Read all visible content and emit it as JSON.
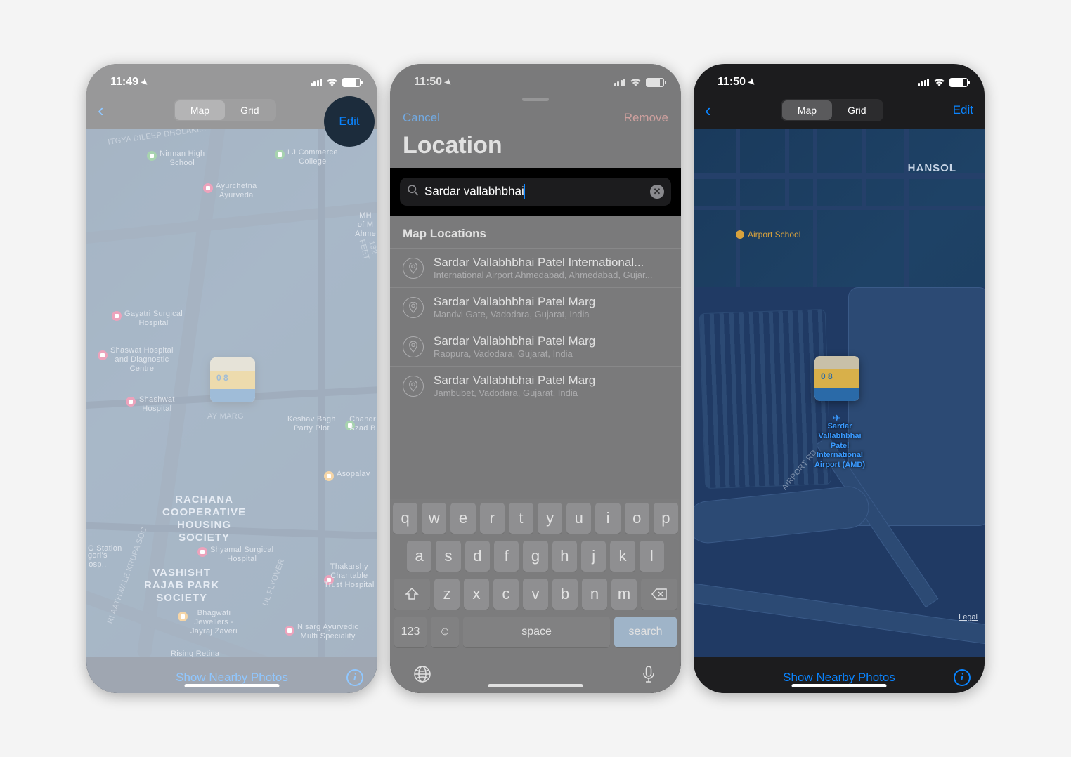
{
  "screen1": {
    "time": "11:49",
    "nav": {
      "back": "‹",
      "map": "Map",
      "grid": "Grid",
      "edit": "Edit"
    },
    "map_labels": {
      "nirman": "Nirman High\nSchool",
      "lj": "LJ Commerce\nCollege",
      "ayur": "Ayurchetna\nAyurveda",
      "mh": "MH\nof M\nAhme",
      "gayatri": "Gayatri Surgical\nHospital",
      "shaswat": "Shaswat Hospital\nand Diagnostic\nCentre",
      "shashwat": "Shashwat\nHospital",
      "keshav": "Keshav Bagh\nParty Plot",
      "chandra": "Chandr\nAzad B",
      "asopalav": "Asopalav",
      "rachana": "RACHANA\nCOOPERATIVE\nHOUSING\nSOCIETY",
      "gstation": "G Station",
      "shyamal": "Shyamal Surgical\nHospital",
      "gori": "gori's\nosp..",
      "vashisht": "VASHISHT\nRAJAB PARK\nSOCIETY",
      "thakarshy": "Thakarshy\nCharitable\nTrust Hospital",
      "bhagwati": "Bhagwati\nJewellers -\nJayraj Zaveri",
      "nisarg": "Nisarg Ayurvedic\nMulti Speciality",
      "rising": "Rising Retina",
      "aathwale": "RI AATHWALE KRUPA SOC",
      "dholakia": "ITGYA DILEEP DHOLAKI...",
      "feet": "132 FEET",
      "ay": "AY MARG",
      "flyover": "UL FLYOVER"
    },
    "bottom": {
      "show": "Show Nearby Photos"
    }
  },
  "screen2": {
    "time": "11:50",
    "cancel": "Cancel",
    "remove": "Remove",
    "title": "Location",
    "search_value": "Sardar vallabhbhai",
    "section": "Map Locations",
    "results": [
      {
        "title": "Sardar Vallabhbhai Patel International...",
        "sub": "International Airport Ahmedabad, Ahmedabad, Gujar..."
      },
      {
        "title": "Sardar Vallabhbhai Patel Marg",
        "sub": "Mandvi Gate, Vadodara, Gujarat, India"
      },
      {
        "title": "Sardar Vallabhbhai Patel Marg",
        "sub": "Raopura, Vadodara, Gujarat, India"
      },
      {
        "title": "Sardar Vallabhbhai Patel Marg",
        "sub": "Jambubet, Vadodara, Gujarat, India"
      }
    ],
    "keyboard": {
      "row1": [
        "q",
        "w",
        "e",
        "r",
        "t",
        "y",
        "u",
        "i",
        "o",
        "p"
      ],
      "row2": [
        "a",
        "s",
        "d",
        "f",
        "g",
        "h",
        "j",
        "k",
        "l"
      ],
      "row3": [
        "z",
        "x",
        "c",
        "v",
        "b",
        "n",
        "m"
      ],
      "bottom": {
        "nums": "123",
        "space": "space",
        "search": "search"
      }
    }
  },
  "screen3": {
    "time": "11:50",
    "nav": {
      "back": "‹",
      "map": "Map",
      "grid": "Grid",
      "edit": "Edit"
    },
    "map": {
      "hansol": "HANSOL",
      "school_poi": "Airport School",
      "airport_label": "Sardar\nVallabhbhai\nPatel\nInternational\nAirport (AMD)",
      "airport_rd": "AIRPORT RD"
    },
    "legal": "Legal",
    "bottom": {
      "show": "Show Nearby Photos"
    }
  }
}
